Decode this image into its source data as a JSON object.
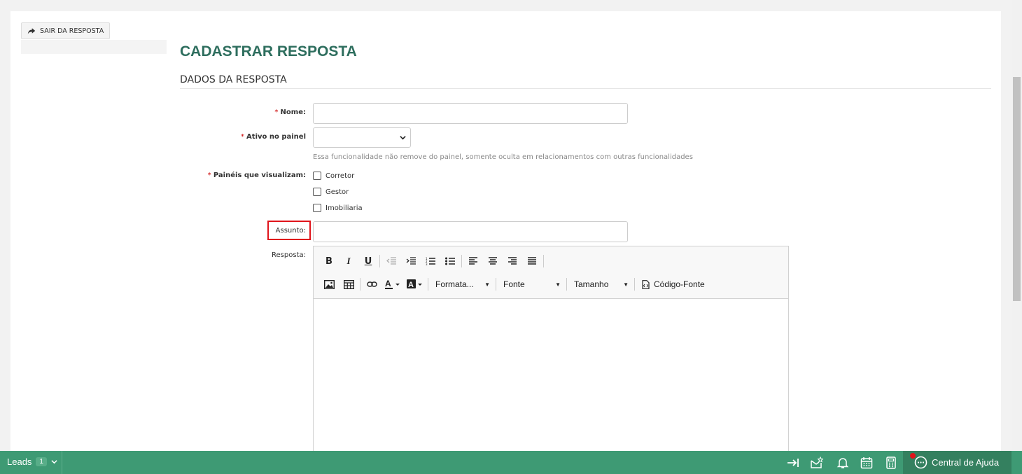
{
  "exit_button": {
    "label": "SAIR DA RESPOSTA"
  },
  "page": {
    "title": "CADASTRAR RESPOSTA",
    "section": "DADOS DA RESPOSTA"
  },
  "form": {
    "nome": {
      "required": "*",
      "label": "Nome:",
      "value": ""
    },
    "ativo": {
      "required": "*",
      "label": "Ativo no painel",
      "selected": "",
      "hint": "Essa funcionalidade não remove do painel, somente oculta em relacionamentos com outras funcionalidades"
    },
    "paineis": {
      "required": "*",
      "label": "Painéis que visualizam:",
      "options": [
        "Corretor",
        "Gestor",
        "Imobiliaria"
      ]
    },
    "assunto": {
      "label": "Assunto:",
      "value": ""
    },
    "resposta": {
      "label": "Resposta:"
    }
  },
  "editor": {
    "bold": "B",
    "italic": "I",
    "underline": "U",
    "format_label": "Formata...",
    "font_label": "Fonte",
    "size_label": "Tamanho",
    "source_label": "Código-Fonte"
  },
  "bottom_bar": {
    "leads_label": "Leads",
    "leads_count": "1",
    "help_label": "Central de Ajuda"
  },
  "colors": {
    "title": "#2e6e5e",
    "bar": "#3e9a74",
    "highlight": "#e0141b"
  }
}
